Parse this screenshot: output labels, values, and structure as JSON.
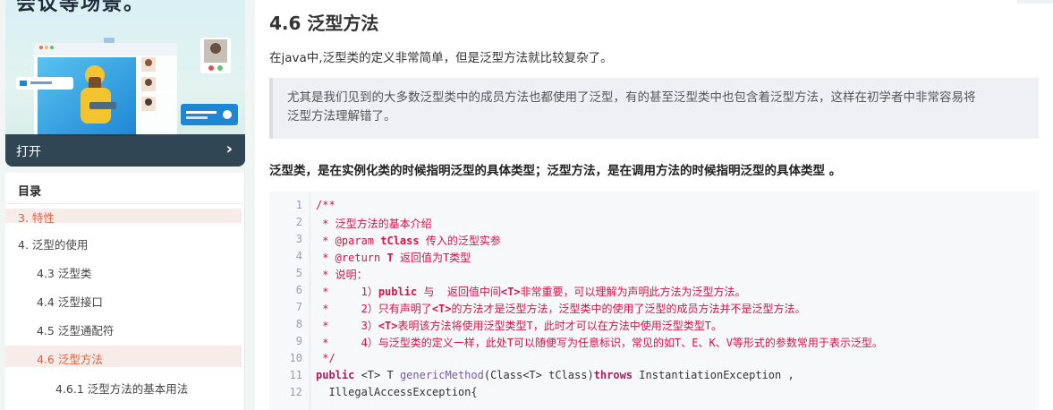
{
  "promo": {
    "heading": "会议等场景。",
    "open_label": "打开",
    "arrow": "›"
  },
  "toc": {
    "header": "目录",
    "items": [
      {
        "label": "3. 特性",
        "active": true
      },
      {
        "label": "4. 泛型的使用",
        "active": false
      },
      {
        "label": "4.3 泛型类",
        "active": false
      },
      {
        "label": "4.4 泛型接口",
        "active": false
      },
      {
        "label": "4.5 泛型通配符",
        "active": false
      },
      {
        "label": "4.6 泛型方法",
        "active": true
      },
      {
        "label": "4.6.1 泛型方法的基本用法",
        "active": false
      }
    ]
  },
  "article": {
    "title": "4.6 泛型方法",
    "intro": "在java中,泛型类的定义非常简单，但是泛型方法就比较复杂了。",
    "quote_line1": "尤其是我们见到的大多数泛型类中的成员方法也都使用了泛型，有的甚至泛型类中也包含着泛型方法，这样在初学者中非常容易将",
    "quote_line2": "泛型方法理解错了。",
    "bold_line": "泛型类，是在实例化类的时候指明泛型的具体类型；泛型方法，是在调用方法的时候指明泛型的具体类型 。"
  },
  "code": {
    "line_numbers": [
      "1",
      "2",
      "3",
      "4",
      "5",
      "6",
      "7",
      "8",
      "9",
      "10",
      "11",
      "12"
    ],
    "l1": "/**",
    "l2": " * 泛型方法的基本介绍",
    "l3a": " * @param ",
    "l3b": "tClass",
    "l3c": " 传入的泛型实参",
    "l4a": " * @return ",
    "l4b": "T",
    "l4c": " 返回值为T类型",
    "l5": " * 说明：",
    "l6a": " *     1）",
    "l6b": "public",
    "l6c": " 与  返回值中间",
    "l6d": "<T>",
    "l6e": "非常重要，可以理解为声明此方法为泛型方法。",
    "l7a": " *     2）只有声明了",
    "l7b": "<T>",
    "l7c": "的方法才是泛型方法，泛型类中的使用了泛型的成员方法并不是泛型方法。",
    "l8a": " *     3）",
    "l8b": "<T>",
    "l8c": "表明该方法将使用泛型类型T，此时才可以在方法中使用泛型类型T。",
    "l9": " *     4）与泛型类的定义一样，此处T可以随便写为任意标识，常见的如T、E、K、V等形式的参数常用于表示泛型。",
    "l10": " */",
    "l11a": "public",
    "l11b": " <T> T ",
    "l11c": "genericMethod",
    "l11d": "(Class<T> tClass)",
    "l11e": "throws",
    "l11f": " InstantiationException ,",
    "l12": "  IllegalAccessException{"
  }
}
